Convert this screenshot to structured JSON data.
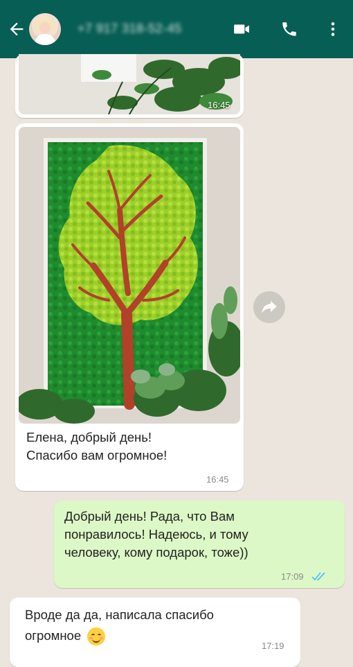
{
  "header": {
    "contact_name": "+7 917 318-52-45",
    "back_icon": "back-arrow-icon",
    "video_icon": "video-call-icon",
    "call_icon": "phone-call-icon",
    "menu_icon": "more-options-icon",
    "colors": {
      "bar": "#075e54",
      "chat_bg": "#ece5dd",
      "outgoing": "#dcf8c6",
      "incoming": "#ffffff",
      "read_ticks": "#4fc3f7"
    }
  },
  "messages": [
    {
      "type": "image",
      "direction": "in",
      "time": "16:45"
    },
    {
      "type": "image_with_caption",
      "direction": "in",
      "lines": [
        "Елена, добрый день!",
        "Спасибо вам огромное!"
      ],
      "time": "16:45"
    },
    {
      "type": "text",
      "direction": "out",
      "lines": [
        "Добрый день! Рада, что Вам",
        "понравилось! Надеюсь, и тому",
        "человеку, кому подарок, тоже))"
      ],
      "time": "17:09",
      "status": "read"
    },
    {
      "type": "text",
      "direction": "in",
      "lines": [
        "Вроде да да, написала спасибо",
        "огромное"
      ],
      "emoji": "☺",
      "time": "17:19"
    }
  ]
}
